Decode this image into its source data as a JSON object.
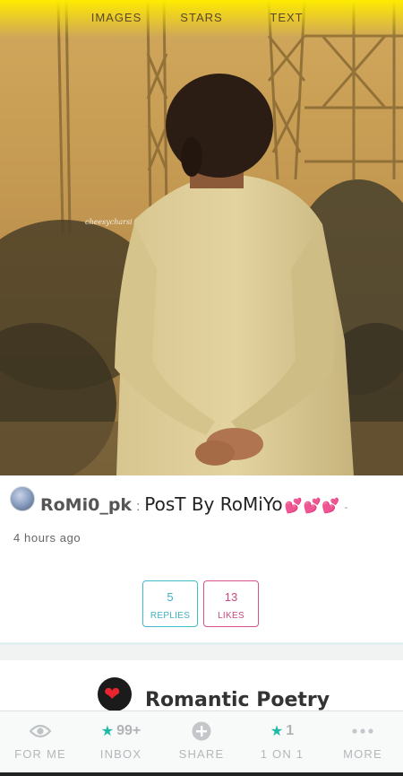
{
  "top_tabs": [
    "IMAGES",
    "STARS",
    "TEXT"
  ],
  "hero": {
    "watermark": "cheesycharsi"
  },
  "post": {
    "username": "RoMi0_pk",
    "separator": ":",
    "title": "PosT By RoMiYo",
    "hearts": "💕💕💕",
    "trailing": "-",
    "time": "4 hours ago",
    "replies": {
      "count": "5",
      "label": "REPLIES"
    },
    "likes": {
      "count": "13",
      "label": "LIKES"
    }
  },
  "category": {
    "title": "Romantic Poetry",
    "icon": "heart-icon"
  },
  "bottom_nav": {
    "for_me": {
      "label": "FOR ME",
      "icon": "eye-icon"
    },
    "inbox": {
      "label": "INBOX",
      "count": "99+",
      "icon": "star-icon"
    },
    "share": {
      "label": "SHARE",
      "icon": "plus-circle-icon"
    },
    "one_on_one": {
      "label": "1 ON 1",
      "count": "1",
      "icon": "star-icon"
    },
    "more": {
      "label": "MORE",
      "icon": "more-dots-icon"
    }
  },
  "colors": {
    "accent_teal": "#3fb2c1",
    "accent_pink": "#c8467f",
    "top_bar": "#ffec00"
  }
}
